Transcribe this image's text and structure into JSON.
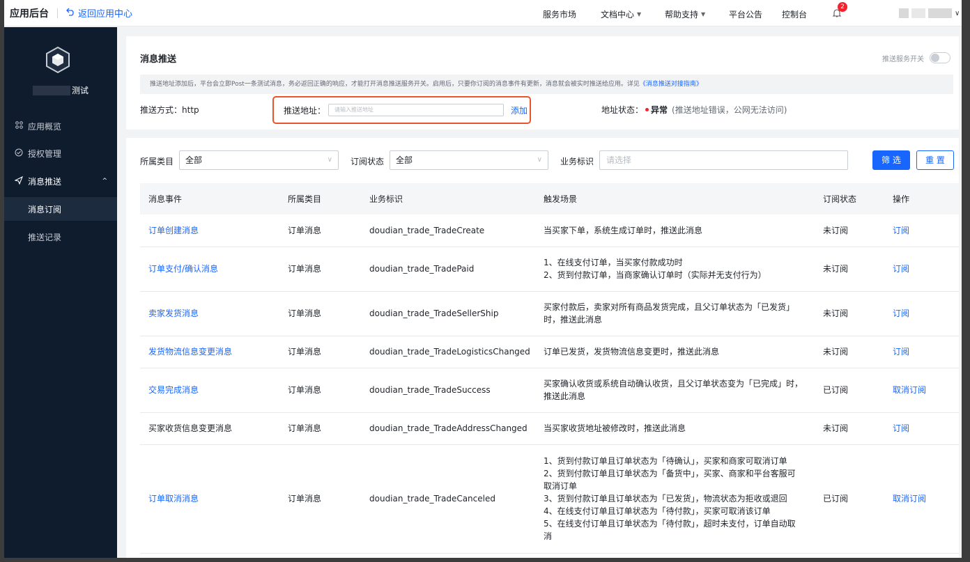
{
  "topbar": {
    "title": "应用后台",
    "back_label": "返回应用中心",
    "nav": [
      {
        "label": "服务市场",
        "dropdown": false
      },
      {
        "label": "文档中心",
        "dropdown": true
      },
      {
        "label": "帮助支持",
        "dropdown": true
      },
      {
        "label": "平台公告",
        "dropdown": false
      },
      {
        "label": "控制台",
        "dropdown": false
      }
    ],
    "notification_count": "2"
  },
  "sidebar": {
    "app_name_suffix": "测试",
    "items": [
      {
        "label": "应用概览",
        "icon": "grid-icon"
      },
      {
        "label": "授权管理",
        "icon": "check-circle-icon"
      },
      {
        "label": "消息推送",
        "icon": "send-icon",
        "expanded": true
      },
      {
        "label": "消息订阅",
        "active": true
      },
      {
        "label": "推送记录"
      }
    ]
  },
  "push": {
    "title": "消息推送",
    "switch_label": "推送服务开关",
    "notice": "推送地址添加后，平台会立即Post一条测试消息，务必返回正确的响应，才能打开消息推送服务开关。启用后，只要你订阅的消息事件有更新，消息就会被实时推送给应用。详见",
    "notice_link": "《消息推送对接指南》",
    "method_label": "推送方式：",
    "method_value": "http",
    "address_label": "推送地址：",
    "address_placeholder": "请输入推送地址",
    "address_add": "添加",
    "status_label": "地址状态：",
    "status_value": "异常",
    "status_note": "(推送地址错误，公网无法访问)",
    "status_color": "#f5222d"
  },
  "filters": {
    "category_label": "所属类目",
    "category_value": "全部",
    "sub_status_label": "订阅状态",
    "sub_status_value": "全部",
    "biz_id_label": "业务标识",
    "biz_id_placeholder": "请选择",
    "filter_btn": "筛 选",
    "reset_btn": "重 置"
  },
  "table": {
    "headers": [
      "消息事件",
      "所属类目",
      "业务标识",
      "触发场景",
      "订阅状态",
      "操作"
    ],
    "rows": [
      {
        "event": "订单创建消息",
        "category": "订单消息",
        "biz": "doudian_trade_TradeCreate",
        "scene": [
          "当买家下单，系统生成订单时，推送此消息"
        ],
        "status": "未订阅",
        "action": "订阅"
      },
      {
        "event": "订单支付/确认消息",
        "category": "订单消息",
        "biz": "doudian_trade_TradePaid",
        "scene": [
          "1、在线支付订单，当买家付款成功时",
          "2、货到付款订单，当商家确认订单时（实际并无支付行为）"
        ],
        "status": "未订阅",
        "action": "订阅"
      },
      {
        "event": "卖家发货消息",
        "category": "订单消息",
        "biz": "doudian_trade_TradeSellerShip",
        "scene": [
          "买家付款后，卖家对所有商品发货完成，且父订单状态为「已发货」",
          "时，推送此消息"
        ],
        "status": "未订阅",
        "action": "订阅"
      },
      {
        "event": "发货物流信息变更消息",
        "category": "订单消息",
        "biz": "doudian_trade_TradeLogisticsChanged",
        "scene": [
          "订单已发货，发货物流信息变更时，推送此消息"
        ],
        "status": "未订阅",
        "action": "订阅"
      },
      {
        "event": "交易完成消息",
        "category": "订单消息",
        "biz": "doudian_trade_TradeSuccess",
        "scene": [
          "买家确认收货或系统自动确认收货，且父订单状态变为「已完成」时，",
          "推送此消息"
        ],
        "status": "已订阅",
        "action": "取消订阅"
      },
      {
        "event": "买家收货信息变更消息",
        "category": "订单消息",
        "biz": "doudian_trade_TradeAddressChanged",
        "scene": [
          "当买家收货地址被修改时，推送此消息"
        ],
        "status": "未订阅",
        "action": "订阅"
      },
      {
        "event": "订单取消消息",
        "category": "订单消息",
        "biz": "doudian_trade_TradeCanceled",
        "scene": [
          "1、货到付款订单且订单状态为「待确认」，买家和商家可取消订单",
          "2、货到付款订单且订单状态为「备货中」，买家、商家和平台客服可",
          "取消订单",
          "3、货到付款订单且订单状态为「已发货」，物流状态为拒收或退回",
          "4、在线支付订单且订单状态为「待付款」，买家可取消该订单",
          "5、在线支付订单且订单状态为「待付款」，超时未支付，订单自动取",
          "消"
        ],
        "status": "已订阅",
        "action": "取消订阅"
      }
    ]
  }
}
